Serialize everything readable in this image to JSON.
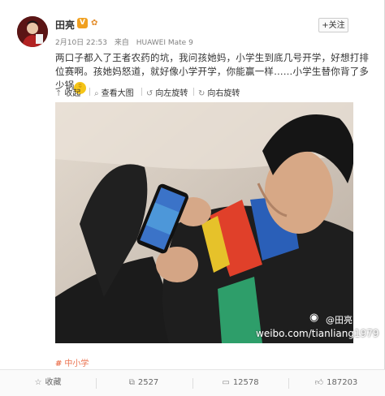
{
  "user": {
    "name": "田亮",
    "verified_badge": "V",
    "level_badge": "✿",
    "follow_label": "+关注"
  },
  "meta": {
    "date": "2月10日 22:53",
    "from": "来自",
    "device": "HUAWEI Mate 9"
  },
  "post": {
    "text": "两口子都入了王者农药的坑，我问孩她妈，小学生到底几号开学，好想打排位赛啊。孩她妈怒道，就好像小学开学，你能赢一样……小学生替你背了多少锅"
  },
  "toolbar": {
    "items": [
      {
        "icon": "collapse-icon",
        "label": "收起"
      },
      {
        "icon": "zoom-icon",
        "label": "查看大图"
      },
      {
        "icon": "rotate-left-icon",
        "label": "向左旋转"
      },
      {
        "icon": "rotate-right-icon",
        "label": "向右旋转"
      }
    ]
  },
  "image": {
    "watermark_user": "@田亮",
    "watermark_url": "weibo.com/tianliang1979"
  },
  "topic": {
    "label": "中小学"
  },
  "actions": [
    {
      "icon": "star-icon",
      "label": "收藏"
    },
    {
      "icon": "share-icon",
      "label": "2527"
    },
    {
      "icon": "comment-icon",
      "label": "12578"
    },
    {
      "icon": "like-icon",
      "label": "187203"
    }
  ],
  "colors": {
    "link": "#eb7350",
    "follow_plus": "#ff8140",
    "verified": "#f0a020"
  }
}
